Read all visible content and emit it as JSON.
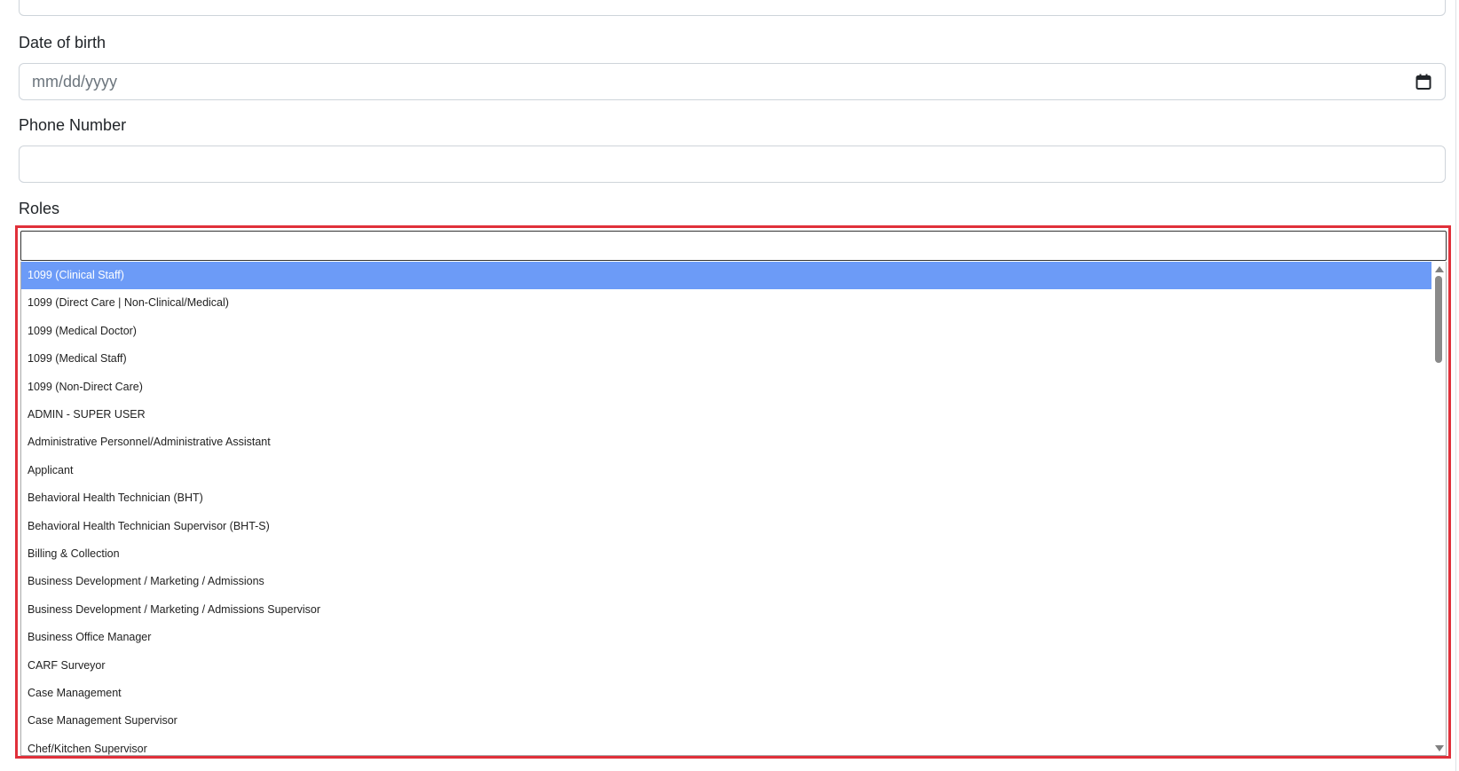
{
  "form": {
    "date_of_birth_label": "Date of birth",
    "date_of_birth_placeholder": "mm/dd/yyyy",
    "phone_label": "Phone Number",
    "phone_value": "",
    "roles_label": "Roles",
    "roles_search_value": ""
  },
  "roles_dropdown": {
    "selected_index": 0,
    "options": [
      "1099 (Clinical Staff)",
      "1099 (Direct Care | Non-Clinical/Medical)",
      "1099 (Medical Doctor)",
      "1099 (Medical Staff)",
      "1099 (Non-Direct Care)",
      "ADMIN - SUPER USER",
      "Administrative Personnel/Administrative Assistant",
      "Applicant",
      "Behavioral Health Technician (BHT)",
      "Behavioral Health Technician Supervisor (BHT-S)",
      "Billing & Collection",
      "Business Development / Marketing / Admissions",
      "Business Development / Marketing / Admissions Supervisor",
      "Business Office Manager",
      "CARF Surveyor",
      "Case Management",
      "Case Management Supervisor",
      "Chef/Kitchen Supervisor"
    ]
  },
  "colors": {
    "highlight": "#e0303a",
    "selected_option_bg": "#6c9bf7"
  },
  "icons": {
    "date_picker": "calendar-icon"
  }
}
